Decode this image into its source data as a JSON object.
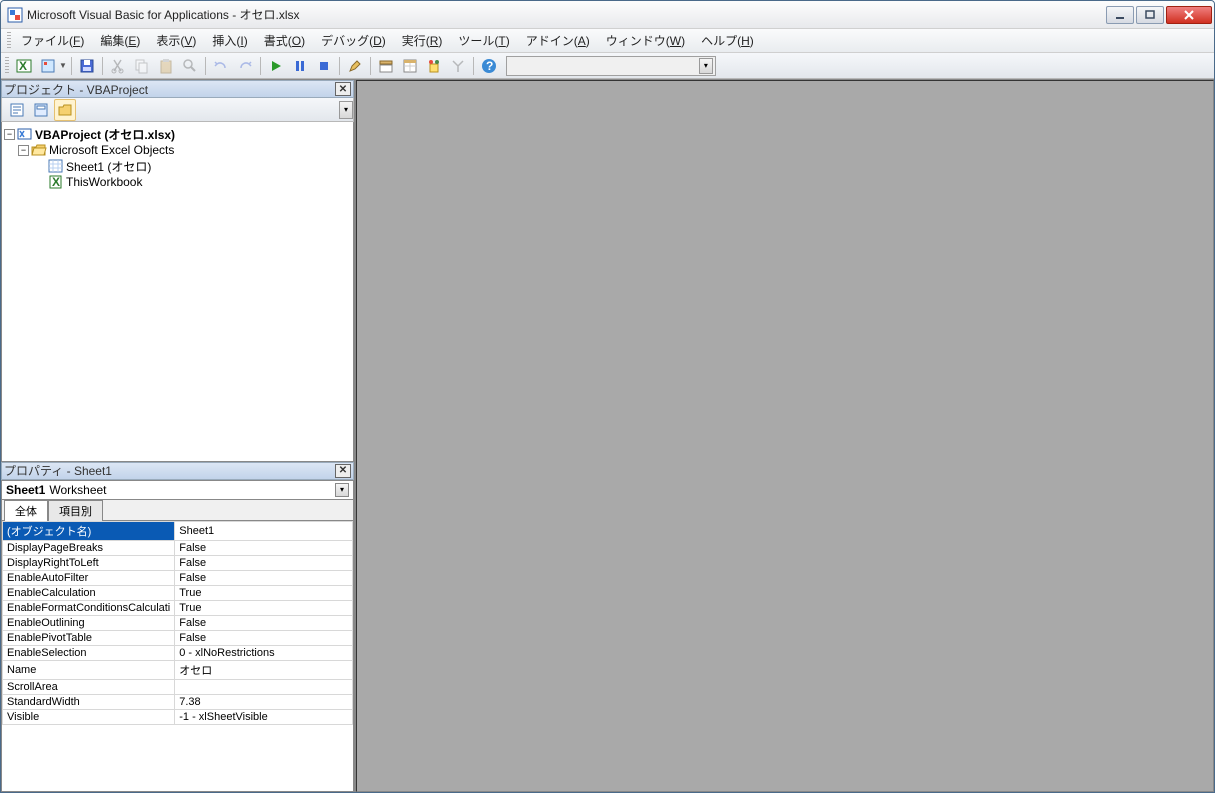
{
  "window": {
    "title": "Microsoft Visual Basic for Applications - オセロ.xlsx"
  },
  "menu": {
    "items": [
      {
        "label": "ファイル",
        "key": "F"
      },
      {
        "label": "編集",
        "key": "E"
      },
      {
        "label": "表示",
        "key": "V"
      },
      {
        "label": "挿入",
        "key": "I"
      },
      {
        "label": "書式",
        "key": "O"
      },
      {
        "label": "デバッグ",
        "key": "D"
      },
      {
        "label": "実行",
        "key": "R"
      },
      {
        "label": "ツール",
        "key": "T"
      },
      {
        "label": "アドイン",
        "key": "A"
      },
      {
        "label": "ウィンドウ",
        "key": "W"
      },
      {
        "label": "ヘルプ",
        "key": "H"
      }
    ]
  },
  "project_panel": {
    "title": "プロジェクト - VBAProject",
    "tree": {
      "root": "VBAProject (オセロ.xlsx)",
      "folder": "Microsoft Excel Objects",
      "items": [
        "Sheet1 (オセロ)",
        "ThisWorkbook"
      ]
    }
  },
  "properties_panel": {
    "title": "プロパティ - Sheet1",
    "object_name": "Sheet1",
    "object_type": "Worksheet",
    "tabs": {
      "all": "全体",
      "category": "項目別"
    },
    "rows": [
      {
        "name": "(オブジェクト名)",
        "value": "Sheet1",
        "selected": true
      },
      {
        "name": "DisplayPageBreaks",
        "value": "False"
      },
      {
        "name": "DisplayRightToLeft",
        "value": "False"
      },
      {
        "name": "EnableAutoFilter",
        "value": "False"
      },
      {
        "name": "EnableCalculation",
        "value": "True"
      },
      {
        "name": "EnableFormatConditionsCalculati",
        "value": "True"
      },
      {
        "name": "EnableOutlining",
        "value": "False"
      },
      {
        "name": "EnablePivotTable",
        "value": "False"
      },
      {
        "name": "EnableSelection",
        "value": "0 - xlNoRestrictions"
      },
      {
        "name": "Name",
        "value": "オセロ"
      },
      {
        "name": "ScrollArea",
        "value": ""
      },
      {
        "name": "StandardWidth",
        "value": "7.38"
      },
      {
        "name": "Visible",
        "value": "-1 - xlSheetVisible"
      }
    ]
  }
}
